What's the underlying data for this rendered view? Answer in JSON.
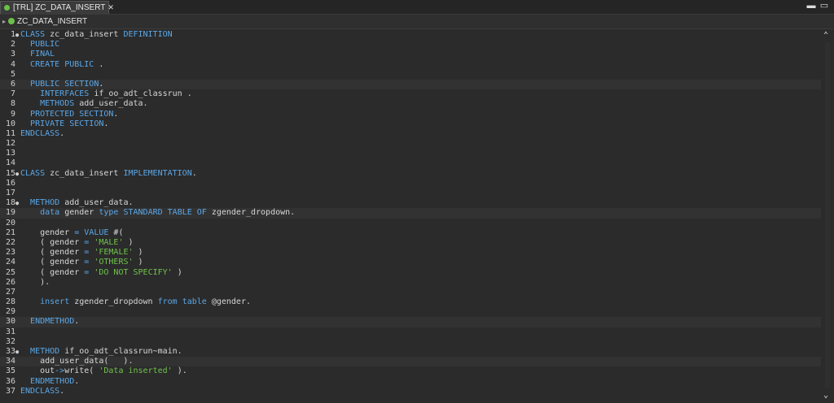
{
  "tab": {
    "title": "[TRL] ZC_DATA_INSERT",
    "close": "✕"
  },
  "window_controls": {
    "minimize": "▬",
    "maximize": "▭"
  },
  "breadcrumb": {
    "label": "ZC_DATA_INSERT"
  },
  "editor": {
    "lines": [
      {
        "n": "1",
        "fold": "●",
        "tokens": [
          [
            "kw",
            "CLASS"
          ],
          [
            "plain",
            " zc_data_insert "
          ],
          [
            "kw",
            "DEFINITION"
          ]
        ]
      },
      {
        "n": "2",
        "fold": "",
        "tokens": [
          [
            "plain",
            "  "
          ],
          [
            "kw",
            "PUBLIC"
          ]
        ]
      },
      {
        "n": "3",
        "fold": "",
        "tokens": [
          [
            "plain",
            "  "
          ],
          [
            "kw",
            "FINAL"
          ]
        ]
      },
      {
        "n": "4",
        "fold": "",
        "tokens": [
          [
            "plain",
            "  "
          ],
          [
            "kw",
            "CREATE PUBLIC"
          ],
          [
            "plain",
            " ."
          ]
        ]
      },
      {
        "n": "5",
        "fold": "",
        "tokens": []
      },
      {
        "n": "6",
        "fold": "",
        "tokens": [
          [
            "plain",
            "  "
          ],
          [
            "kw",
            "PUBLIC SECTION"
          ],
          [
            "plain",
            "."
          ]
        ]
      },
      {
        "n": "7",
        "fold": "",
        "tokens": [
          [
            "plain",
            "    "
          ],
          [
            "kw",
            "INTERFACES"
          ],
          [
            "plain",
            " if_oo_adt_classrun ."
          ]
        ]
      },
      {
        "n": "8",
        "fold": "",
        "tokens": [
          [
            "plain",
            "    "
          ],
          [
            "kw",
            "METHODS"
          ],
          [
            "plain",
            " add_user_data."
          ]
        ]
      },
      {
        "n": "9",
        "fold": "",
        "tokens": [
          [
            "plain",
            "  "
          ],
          [
            "kw",
            "PROTECTED SECTION"
          ],
          [
            "plain",
            "."
          ]
        ]
      },
      {
        "n": "10",
        "fold": "",
        "tokens": [
          [
            "plain",
            "  "
          ],
          [
            "kw",
            "PRIVATE SECTION"
          ],
          [
            "plain",
            "."
          ]
        ]
      },
      {
        "n": "11",
        "fold": "",
        "tokens": [
          [
            "kw",
            "ENDCLASS"
          ],
          [
            "plain",
            "."
          ]
        ]
      },
      {
        "n": "12",
        "fold": "",
        "tokens": []
      },
      {
        "n": "13",
        "fold": "",
        "tokens": []
      },
      {
        "n": "14",
        "fold": "",
        "tokens": []
      },
      {
        "n": "15",
        "fold": "●",
        "tokens": [
          [
            "kw",
            "CLASS"
          ],
          [
            "plain",
            " zc_data_insert "
          ],
          [
            "kw",
            "IMPLEMENTATION"
          ],
          [
            "plain",
            "."
          ]
        ]
      },
      {
        "n": "16",
        "fold": "",
        "tokens": []
      },
      {
        "n": "17",
        "fold": "",
        "tokens": []
      },
      {
        "n": "18",
        "fold": "●",
        "tokens": [
          [
            "plain",
            "  "
          ],
          [
            "kw",
            "METHOD"
          ],
          [
            "plain",
            " add_user_data."
          ]
        ]
      },
      {
        "n": "19",
        "fold": "",
        "tokens": [
          [
            "plain",
            "    "
          ],
          [
            "kw",
            "data"
          ],
          [
            "plain",
            " gender "
          ],
          [
            "kw",
            "type STANDARD TABLE OF"
          ],
          [
            "plain",
            " zgender_dropdown."
          ]
        ]
      },
      {
        "n": "20",
        "fold": "",
        "tokens": []
      },
      {
        "n": "21",
        "fold": "",
        "tokens": [
          [
            "plain",
            "    gender "
          ],
          [
            "op",
            "="
          ],
          [
            "plain",
            " "
          ],
          [
            "kw",
            "VALUE"
          ],
          [
            "plain",
            " #("
          ]
        ]
      },
      {
        "n": "22",
        "fold": "",
        "tokens": [
          [
            "plain",
            "    ( gender "
          ],
          [
            "op",
            "="
          ],
          [
            "plain",
            " "
          ],
          [
            "str",
            "'MALE'"
          ],
          [
            "plain",
            " )"
          ]
        ]
      },
      {
        "n": "23",
        "fold": "",
        "tokens": [
          [
            "plain",
            "    ( gender "
          ],
          [
            "op",
            "="
          ],
          [
            "plain",
            " "
          ],
          [
            "str",
            "'FEMALE'"
          ],
          [
            "plain",
            " )"
          ]
        ]
      },
      {
        "n": "24",
        "fold": "",
        "tokens": [
          [
            "plain",
            "    ( gender "
          ],
          [
            "op",
            "="
          ],
          [
            "plain",
            " "
          ],
          [
            "str",
            "'OTHERS'"
          ],
          [
            "plain",
            " )"
          ]
        ]
      },
      {
        "n": "25",
        "fold": "",
        "tokens": [
          [
            "plain",
            "    ( gender "
          ],
          [
            "op",
            "="
          ],
          [
            "plain",
            " "
          ],
          [
            "str",
            "'DO NOT SPECIFY'"
          ],
          [
            "plain",
            " )"
          ]
        ]
      },
      {
        "n": "26",
        "fold": "",
        "tokens": [
          [
            "plain",
            "    )."
          ]
        ]
      },
      {
        "n": "27",
        "fold": "",
        "tokens": []
      },
      {
        "n": "28",
        "fold": "",
        "tokens": [
          [
            "plain",
            "    "
          ],
          [
            "kw",
            "insert"
          ],
          [
            "plain",
            " zgender_dropdown "
          ],
          [
            "kw",
            "from table"
          ],
          [
            "plain",
            " @gender."
          ]
        ]
      },
      {
        "n": "29",
        "fold": "",
        "tokens": []
      },
      {
        "n": "30",
        "fold": "",
        "tokens": [
          [
            "plain",
            "  "
          ],
          [
            "kw",
            "ENDMETHOD"
          ],
          [
            "plain",
            "."
          ]
        ]
      },
      {
        "n": "31",
        "fold": "",
        "tokens": []
      },
      {
        "n": "32",
        "fold": "",
        "tokens": []
      },
      {
        "n": "33",
        "fold": "●",
        "tokens": [
          [
            "plain",
            "  "
          ],
          [
            "kw",
            "METHOD"
          ],
          [
            "plain",
            " if_oo_adt_classrun~main."
          ]
        ]
      },
      {
        "n": "34",
        "fold": "",
        "tokens": [
          [
            "plain",
            "    add_user_data(   )."
          ]
        ]
      },
      {
        "n": "35",
        "fold": "",
        "tokens": [
          [
            "plain",
            "    out"
          ],
          [
            "op",
            "->"
          ],
          [
            "plain",
            "write( "
          ],
          [
            "str",
            "'Data inserted'"
          ],
          [
            "plain",
            " )."
          ]
        ]
      },
      {
        "n": "36",
        "fold": "",
        "tokens": [
          [
            "plain",
            "  "
          ],
          [
            "kw",
            "ENDMETHOD"
          ],
          [
            "plain",
            "."
          ]
        ]
      },
      {
        "n": "37",
        "fold": "",
        "tokens": [
          [
            "kw",
            "ENDCLASS"
          ],
          [
            "plain",
            "."
          ]
        ]
      }
    ]
  },
  "scroll": {
    "up": "⌃",
    "down": "⌄"
  }
}
